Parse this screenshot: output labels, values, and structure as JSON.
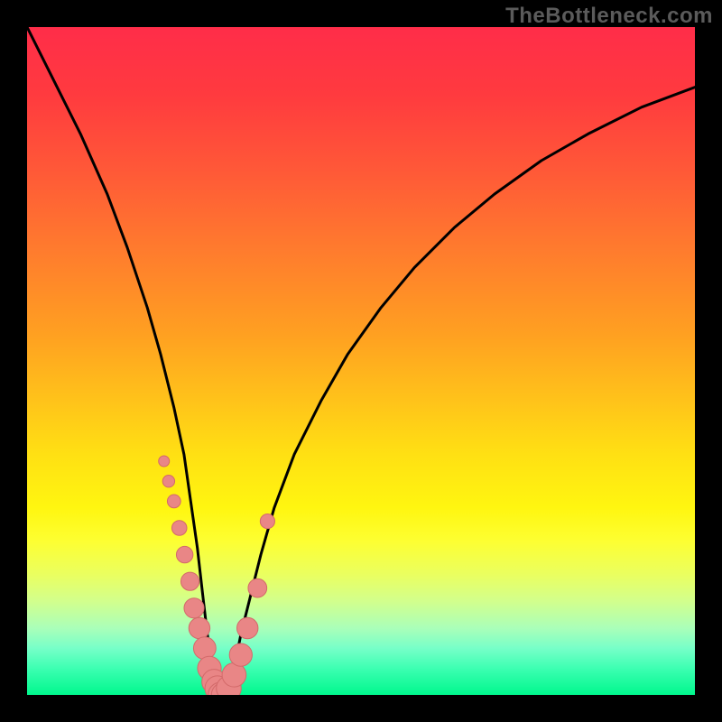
{
  "attribution": "TheBottleneck.com",
  "colors": {
    "page_bg": "#000000",
    "gradient_top": "#ff2d49",
    "gradient_bottom": "#00f78d",
    "curve": "#000000",
    "marker_fill": "#e98686",
    "marker_stroke": "#d36a6a"
  },
  "chart_data": {
    "type": "line",
    "title": "",
    "xlabel": "",
    "ylabel": "",
    "xlim": [
      0,
      100
    ],
    "ylim": [
      0,
      100
    ],
    "grid": false,
    "legend": false,
    "annotations": [],
    "series": [
      {
        "name": "bottleneck-curve",
        "x": [
          0,
          4,
          8,
          12,
          15,
          18,
          20,
          22,
          23.5,
          24.5,
          25.5,
          26.3,
          27,
          27.8,
          28.5,
          29.2,
          30,
          31,
          32,
          33.5,
          35,
          37,
          40,
          44,
          48,
          53,
          58,
          64,
          70,
          77,
          84,
          92,
          100
        ],
        "y": [
          100,
          92,
          84,
          75,
          67,
          58,
          51,
          43,
          36,
          29,
          22,
          15,
          9,
          4,
          1,
          0,
          1,
          4,
          9,
          15,
          21,
          28,
          36,
          44,
          51,
          58,
          64,
          70,
          75,
          80,
          84,
          88,
          91
        ]
      }
    ],
    "markers": {
      "name": "highlighted-points",
      "x": [
        20.5,
        21.2,
        22.0,
        22.8,
        23.6,
        24.4,
        25.0,
        25.8,
        26.6,
        27.3,
        28.0,
        28.5,
        29.0,
        29.5,
        30.2,
        31.0,
        32.0,
        33.0,
        34.5,
        36.0
      ],
      "y": [
        35,
        32,
        29,
        25,
        21,
        17,
        13,
        10,
        7,
        4,
        2,
        1,
        0,
        0,
        1,
        3,
        6,
        10,
        16,
        26
      ],
      "shape": "circle",
      "size_range": [
        6,
        14
      ]
    }
  }
}
